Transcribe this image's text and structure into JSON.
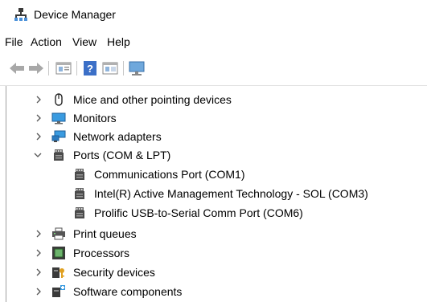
{
  "window": {
    "title": "Device Manager",
    "icon": "device-manager-icon"
  },
  "menu": {
    "items": [
      "File",
      "Action",
      "View",
      "Help"
    ]
  },
  "toolbar": {
    "buttons": [
      "back-icon",
      "forward-icon",
      "properties-icon",
      "help-icon",
      "view-icon",
      "monitor-scan-icon"
    ]
  },
  "tree": {
    "nodes": [
      {
        "label": "Mice and other pointing devices",
        "icon": "mouse-icon",
        "expander": "collapsed",
        "level": 0
      },
      {
        "label": "Monitors",
        "icon": "monitor-icon",
        "expander": "collapsed",
        "level": 0
      },
      {
        "label": "Network adapters",
        "icon": "network-adapter-icon",
        "expander": "collapsed",
        "level": 0
      },
      {
        "label": "Ports (COM & LPT)",
        "icon": "port-icon",
        "expander": "expanded",
        "level": 0
      },
      {
        "label": "Communications Port (COM1)",
        "icon": "port-icon",
        "expander": "none",
        "level": 1
      },
      {
        "label": "Intel(R) Active Management Technology - SOL (COM3)",
        "icon": "port-icon",
        "expander": "none",
        "level": 1
      },
      {
        "label": "Prolific USB-to-Serial Comm Port (COM6)",
        "icon": "port-icon",
        "expander": "none",
        "level": 1
      },
      {
        "label": "Print queues",
        "icon": "printer-icon",
        "expander": "collapsed",
        "level": 0
      },
      {
        "label": "Processors",
        "icon": "processor-icon",
        "expander": "collapsed",
        "level": 0
      },
      {
        "label": "Security devices",
        "icon": "security-key-icon",
        "expander": "collapsed",
        "level": 0
      },
      {
        "label": "Software components",
        "icon": "software-component-icon",
        "expander": "collapsed",
        "level": 0
      }
    ]
  }
}
